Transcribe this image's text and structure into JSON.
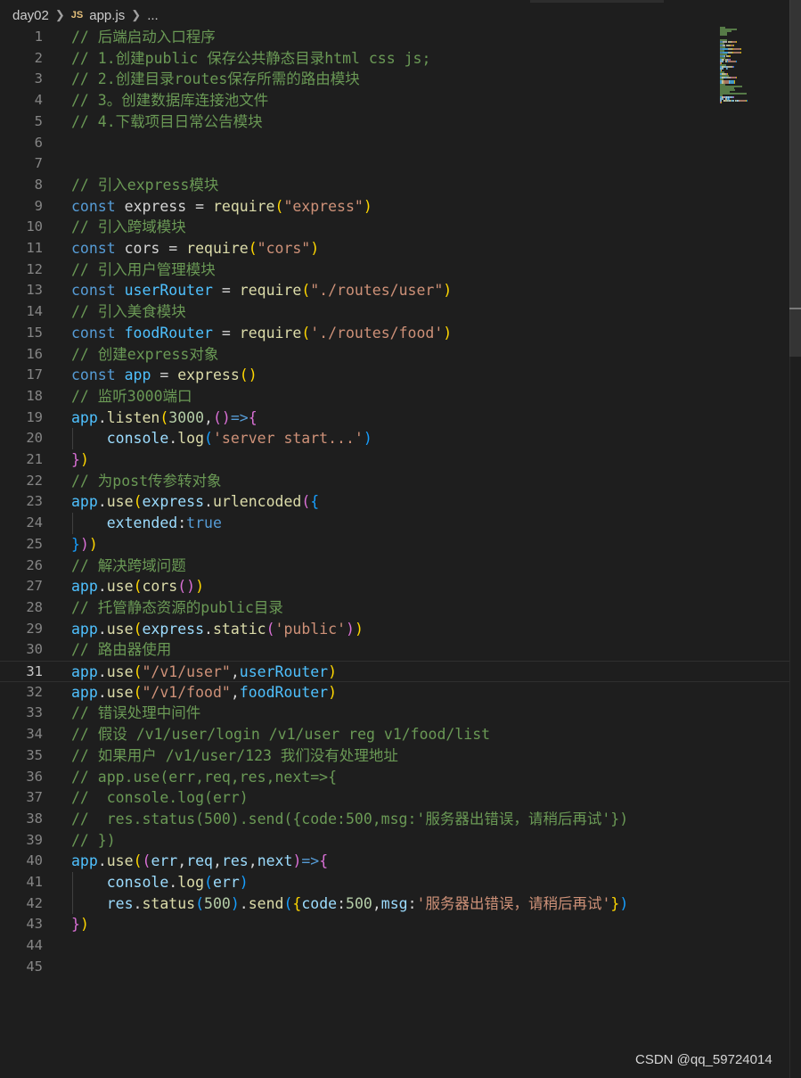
{
  "breadcrumb": {
    "folder": "day02",
    "file_icon": "JS",
    "file": "app.js",
    "more": "..."
  },
  "editor": {
    "current_line": 31,
    "colors": {
      "comment": "#6a9955",
      "keyword": "#569cd6",
      "variable": "#4fc1ff",
      "function": "#dcdcaa",
      "string": "#ce9178",
      "number": "#b5cea8",
      "property": "#9cdcfe",
      "bracket1": "#ffd700",
      "bracket2": "#da70d6",
      "bracket3": "#179fff",
      "text": "#d4d4d4"
    },
    "lines": [
      [
        [
          "// 后端启动入口程序",
          "comment"
        ]
      ],
      [
        [
          "// 1.创建public 保存公共静态目录html css js;",
          "comment"
        ]
      ],
      [
        [
          "// 2.创建目录routes保存所需的路由模块",
          "comment"
        ]
      ],
      [
        [
          "// 3。创建数据库连接池文件",
          "comment"
        ]
      ],
      [
        [
          "// 4.下载项目日常公告模块",
          "comment"
        ]
      ],
      [],
      [],
      [
        [
          "// 引入express模块",
          "comment"
        ]
      ],
      [
        [
          "const",
          "keyword"
        ],
        [
          " express = ",
          "text"
        ],
        [
          "require",
          "function"
        ],
        [
          "(",
          "bracket1"
        ],
        [
          "\"express\"",
          "string"
        ],
        [
          ")",
          "bracket1"
        ]
      ],
      [
        [
          "// 引入跨域模块",
          "comment"
        ]
      ],
      [
        [
          "const",
          "keyword"
        ],
        [
          " cors = ",
          "text"
        ],
        [
          "require",
          "function"
        ],
        [
          "(",
          "bracket1"
        ],
        [
          "\"cors\"",
          "string"
        ],
        [
          ")",
          "bracket1"
        ]
      ],
      [
        [
          "// 引入用户管理模块",
          "comment"
        ]
      ],
      [
        [
          "const",
          "keyword"
        ],
        [
          " ",
          "text"
        ],
        [
          "userRouter",
          "variable"
        ],
        [
          " = ",
          "text"
        ],
        [
          "require",
          "function"
        ],
        [
          "(",
          "bracket1"
        ],
        [
          "\"./routes/user\"",
          "string"
        ],
        [
          ")",
          "bracket1"
        ]
      ],
      [
        [
          "// 引入美食模块",
          "comment"
        ]
      ],
      [
        [
          "const",
          "keyword"
        ],
        [
          " ",
          "text"
        ],
        [
          "foodRouter",
          "variable"
        ],
        [
          " = ",
          "text"
        ],
        [
          "require",
          "function"
        ],
        [
          "(",
          "bracket1"
        ],
        [
          "'./routes/food'",
          "string"
        ],
        [
          ")",
          "bracket1"
        ]
      ],
      [
        [
          "// 创建express对象",
          "comment"
        ]
      ],
      [
        [
          "const",
          "keyword"
        ],
        [
          " ",
          "text"
        ],
        [
          "app",
          "variable"
        ],
        [
          " = ",
          "text"
        ],
        [
          "express",
          "function"
        ],
        [
          "()",
          "bracket1"
        ]
      ],
      [
        [
          "// 监听3000端口",
          "comment"
        ]
      ],
      [
        [
          "app",
          "variable"
        ],
        [
          ".",
          "text"
        ],
        [
          "listen",
          "function"
        ],
        [
          "(",
          "bracket1"
        ],
        [
          "3000",
          "number"
        ],
        [
          ",",
          "text"
        ],
        [
          "()",
          "bracket2"
        ],
        [
          "=>",
          "keyword"
        ],
        [
          "{",
          "bracket2"
        ]
      ],
      [
        [
          "    console",
          "property"
        ],
        [
          ".",
          "text"
        ],
        [
          "log",
          "function"
        ],
        [
          "(",
          "bracket3"
        ],
        [
          "'server start...'",
          "string"
        ],
        [
          ")",
          "bracket3"
        ]
      ],
      [
        [
          "}",
          "bracket2"
        ],
        [
          ")",
          "bracket1"
        ]
      ],
      [
        [
          "// 为post传参转对象",
          "comment"
        ]
      ],
      [
        [
          "app",
          "variable"
        ],
        [
          ".",
          "text"
        ],
        [
          "use",
          "function"
        ],
        [
          "(",
          "bracket1"
        ],
        [
          "express",
          "property"
        ],
        [
          ".",
          "text"
        ],
        [
          "urlencoded",
          "function"
        ],
        [
          "(",
          "bracket2"
        ],
        [
          "{",
          "bracket3"
        ]
      ],
      [
        [
          "    extended",
          "property"
        ],
        [
          ":",
          "text"
        ],
        [
          "true",
          "keyword"
        ]
      ],
      [
        [
          "}",
          "bracket3"
        ],
        [
          ")",
          "bracket2"
        ],
        [
          ")",
          "bracket1"
        ]
      ],
      [
        [
          "// 解决跨域问题",
          "comment"
        ]
      ],
      [
        [
          "app",
          "variable"
        ],
        [
          ".",
          "text"
        ],
        [
          "use",
          "function"
        ],
        [
          "(",
          "bracket1"
        ],
        [
          "cors",
          "function"
        ],
        [
          "()",
          "bracket2"
        ],
        [
          ")",
          "bracket1"
        ]
      ],
      [
        [
          "// 托管静态资源的public目录",
          "comment"
        ]
      ],
      [
        [
          "app",
          "variable"
        ],
        [
          ".",
          "text"
        ],
        [
          "use",
          "function"
        ],
        [
          "(",
          "bracket1"
        ],
        [
          "express",
          "property"
        ],
        [
          ".",
          "text"
        ],
        [
          "static",
          "function"
        ],
        [
          "(",
          "bracket2"
        ],
        [
          "'public'",
          "string"
        ],
        [
          ")",
          "bracket2"
        ],
        [
          ")",
          "bracket1"
        ]
      ],
      [
        [
          "// 路由器使用",
          "comment"
        ]
      ],
      [
        [
          "app",
          "variable"
        ],
        [
          ".",
          "text"
        ],
        [
          "use",
          "function"
        ],
        [
          "(",
          "bracket1"
        ],
        [
          "\"/v1/user\"",
          "string"
        ],
        [
          ",",
          "text"
        ],
        [
          "userRouter",
          "variable"
        ],
        [
          ")",
          "bracket1"
        ]
      ],
      [
        [
          "app",
          "variable"
        ],
        [
          ".",
          "text"
        ],
        [
          "use",
          "function"
        ],
        [
          "(",
          "bracket1"
        ],
        [
          "\"/v1/food\"",
          "string"
        ],
        [
          ",",
          "text"
        ],
        [
          "foodRouter",
          "variable"
        ],
        [
          ")",
          "bracket1"
        ]
      ],
      [
        [
          "// 错误处理中间件",
          "comment"
        ]
      ],
      [
        [
          "// 假设 /v1/user/login /v1/user reg v1/food/list",
          "comment"
        ]
      ],
      [
        [
          "// 如果用户 /v1/user/123 我们没有处理地址",
          "comment"
        ]
      ],
      [
        [
          "// app.use(err,req,res,next=>{",
          "comment"
        ]
      ],
      [
        [
          "//  console.log(err)",
          "comment"
        ]
      ],
      [
        [
          "//  res.status(500).send({code:500,msg:'服务器出错误，请稍后再试'})",
          "comment"
        ]
      ],
      [
        [
          "// })",
          "comment"
        ]
      ],
      [
        [
          "app",
          "variable"
        ],
        [
          ".",
          "text"
        ],
        [
          "use",
          "function"
        ],
        [
          "(",
          "bracket1"
        ],
        [
          "(",
          "bracket2"
        ],
        [
          "err",
          "property"
        ],
        [
          ",",
          "text"
        ],
        [
          "req",
          "property"
        ],
        [
          ",",
          "text"
        ],
        [
          "res",
          "property"
        ],
        [
          ",",
          "text"
        ],
        [
          "next",
          "property"
        ],
        [
          ")",
          "bracket2"
        ],
        [
          "=>",
          "keyword"
        ],
        [
          "{",
          "bracket2"
        ]
      ],
      [
        [
          "    console",
          "property"
        ],
        [
          ".",
          "text"
        ],
        [
          "log",
          "function"
        ],
        [
          "(",
          "bracket3"
        ],
        [
          "err",
          "property"
        ],
        [
          ")",
          "bracket3"
        ]
      ],
      [
        [
          "    res",
          "property"
        ],
        [
          ".",
          "text"
        ],
        [
          "status",
          "function"
        ],
        [
          "(",
          "bracket3"
        ],
        [
          "500",
          "number"
        ],
        [
          ")",
          "bracket3"
        ],
        [
          ".",
          "text"
        ],
        [
          "send",
          "function"
        ],
        [
          "(",
          "bracket3"
        ],
        [
          "{",
          "bracket1"
        ],
        [
          "code",
          "property"
        ],
        [
          ":",
          "text"
        ],
        [
          "500",
          "number"
        ],
        [
          ",",
          "text"
        ],
        [
          "msg",
          "property"
        ],
        [
          ":",
          "text"
        ],
        [
          "'服务器出错误，请稍后再试'",
          "string"
        ],
        [
          "}",
          "bracket1"
        ],
        [
          ")",
          "bracket3"
        ]
      ],
      [
        [
          "}",
          "bracket2"
        ],
        [
          ")",
          "bracket1"
        ]
      ],
      [],
      []
    ]
  },
  "watermark": "CSDN @qq_59724014"
}
